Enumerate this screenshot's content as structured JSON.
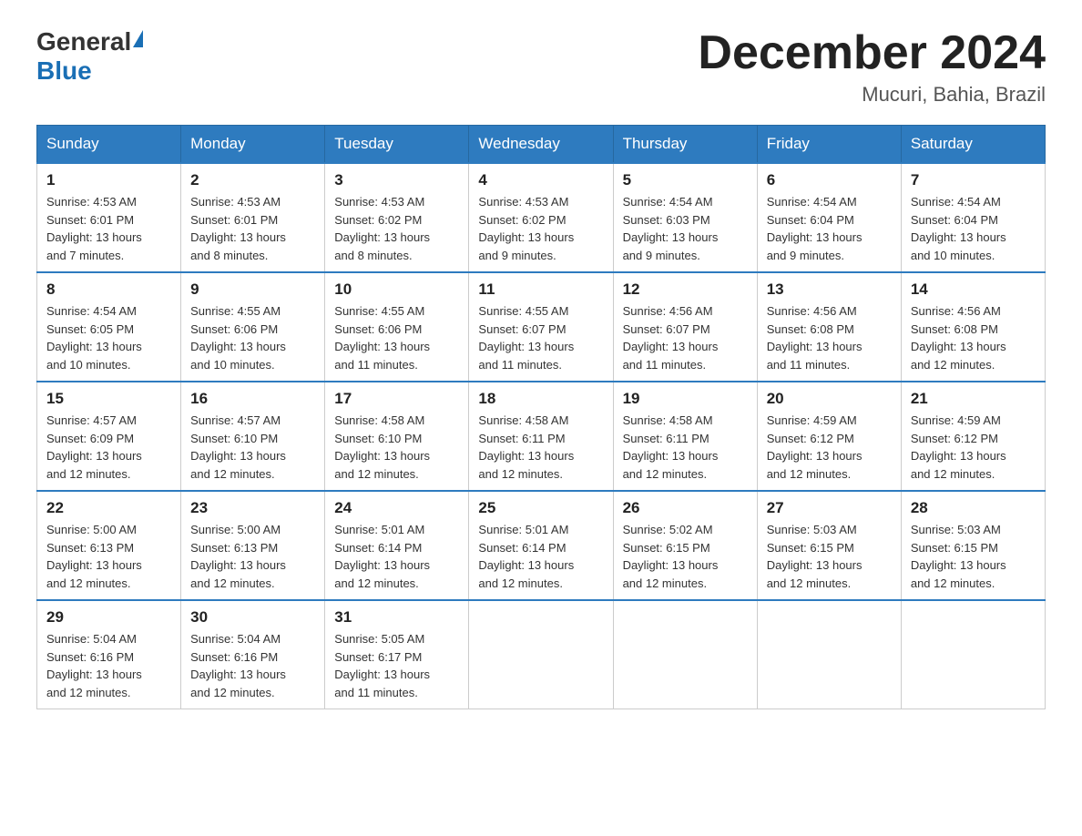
{
  "header": {
    "logo_general": "General",
    "logo_blue": "Blue",
    "month_title": "December 2024",
    "location": "Mucuri, Bahia, Brazil"
  },
  "weekdays": [
    "Sunday",
    "Monday",
    "Tuesday",
    "Wednesday",
    "Thursday",
    "Friday",
    "Saturday"
  ],
  "weeks": [
    [
      {
        "day": "1",
        "sunrise": "4:53 AM",
        "sunset": "6:01 PM",
        "daylight": "13 hours and 7 minutes."
      },
      {
        "day": "2",
        "sunrise": "4:53 AM",
        "sunset": "6:01 PM",
        "daylight": "13 hours and 8 minutes."
      },
      {
        "day": "3",
        "sunrise": "4:53 AM",
        "sunset": "6:02 PM",
        "daylight": "13 hours and 8 minutes."
      },
      {
        "day": "4",
        "sunrise": "4:53 AM",
        "sunset": "6:02 PM",
        "daylight": "13 hours and 9 minutes."
      },
      {
        "day": "5",
        "sunrise": "4:54 AM",
        "sunset": "6:03 PM",
        "daylight": "13 hours and 9 minutes."
      },
      {
        "day": "6",
        "sunrise": "4:54 AM",
        "sunset": "6:04 PM",
        "daylight": "13 hours and 9 minutes."
      },
      {
        "day": "7",
        "sunrise": "4:54 AM",
        "sunset": "6:04 PM",
        "daylight": "13 hours and 10 minutes."
      }
    ],
    [
      {
        "day": "8",
        "sunrise": "4:54 AM",
        "sunset": "6:05 PM",
        "daylight": "13 hours and 10 minutes."
      },
      {
        "day": "9",
        "sunrise": "4:55 AM",
        "sunset": "6:06 PM",
        "daylight": "13 hours and 10 minutes."
      },
      {
        "day": "10",
        "sunrise": "4:55 AM",
        "sunset": "6:06 PM",
        "daylight": "13 hours and 11 minutes."
      },
      {
        "day": "11",
        "sunrise": "4:55 AM",
        "sunset": "6:07 PM",
        "daylight": "13 hours and 11 minutes."
      },
      {
        "day": "12",
        "sunrise": "4:56 AM",
        "sunset": "6:07 PM",
        "daylight": "13 hours and 11 minutes."
      },
      {
        "day": "13",
        "sunrise": "4:56 AM",
        "sunset": "6:08 PM",
        "daylight": "13 hours and 11 minutes."
      },
      {
        "day": "14",
        "sunrise": "4:56 AM",
        "sunset": "6:08 PM",
        "daylight": "13 hours and 12 minutes."
      }
    ],
    [
      {
        "day": "15",
        "sunrise": "4:57 AM",
        "sunset": "6:09 PM",
        "daylight": "13 hours and 12 minutes."
      },
      {
        "day": "16",
        "sunrise": "4:57 AM",
        "sunset": "6:10 PM",
        "daylight": "13 hours and 12 minutes."
      },
      {
        "day": "17",
        "sunrise": "4:58 AM",
        "sunset": "6:10 PM",
        "daylight": "13 hours and 12 minutes."
      },
      {
        "day": "18",
        "sunrise": "4:58 AM",
        "sunset": "6:11 PM",
        "daylight": "13 hours and 12 minutes."
      },
      {
        "day": "19",
        "sunrise": "4:58 AM",
        "sunset": "6:11 PM",
        "daylight": "13 hours and 12 minutes."
      },
      {
        "day": "20",
        "sunrise": "4:59 AM",
        "sunset": "6:12 PM",
        "daylight": "13 hours and 12 minutes."
      },
      {
        "day": "21",
        "sunrise": "4:59 AM",
        "sunset": "6:12 PM",
        "daylight": "13 hours and 12 minutes."
      }
    ],
    [
      {
        "day": "22",
        "sunrise": "5:00 AM",
        "sunset": "6:13 PM",
        "daylight": "13 hours and 12 minutes."
      },
      {
        "day": "23",
        "sunrise": "5:00 AM",
        "sunset": "6:13 PM",
        "daylight": "13 hours and 12 minutes."
      },
      {
        "day": "24",
        "sunrise": "5:01 AM",
        "sunset": "6:14 PM",
        "daylight": "13 hours and 12 minutes."
      },
      {
        "day": "25",
        "sunrise": "5:01 AM",
        "sunset": "6:14 PM",
        "daylight": "13 hours and 12 minutes."
      },
      {
        "day": "26",
        "sunrise": "5:02 AM",
        "sunset": "6:15 PM",
        "daylight": "13 hours and 12 minutes."
      },
      {
        "day": "27",
        "sunrise": "5:03 AM",
        "sunset": "6:15 PM",
        "daylight": "13 hours and 12 minutes."
      },
      {
        "day": "28",
        "sunrise": "5:03 AM",
        "sunset": "6:15 PM",
        "daylight": "13 hours and 12 minutes."
      }
    ],
    [
      {
        "day": "29",
        "sunrise": "5:04 AM",
        "sunset": "6:16 PM",
        "daylight": "13 hours and 12 minutes."
      },
      {
        "day": "30",
        "sunrise": "5:04 AM",
        "sunset": "6:16 PM",
        "daylight": "13 hours and 12 minutes."
      },
      {
        "day": "31",
        "sunrise": "5:05 AM",
        "sunset": "6:17 PM",
        "daylight": "13 hours and 11 minutes."
      },
      null,
      null,
      null,
      null
    ]
  ],
  "labels": {
    "sunrise": "Sunrise:",
    "sunset": "Sunset:",
    "daylight": "Daylight:"
  }
}
